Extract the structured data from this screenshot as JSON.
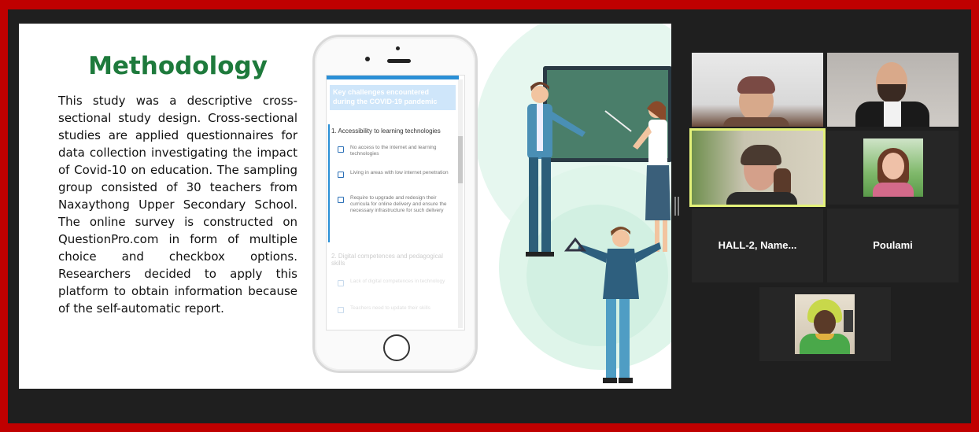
{
  "slide": {
    "title": "Methodology",
    "body": "This study was a descriptive cross-sectional study design. Cross-sectional studies are applied questionnaires for data collection investigating the impact of Covid-10 on education. The sampling group consisted of 30 teachers from Naxaythong Upper Secondary School. The online survey is constructed on QuestionPro.com in form of multiple choice and checkbox options. Researchers decided to apply this platform to obtain information because of the self-automatic report.",
    "phone": {
      "banner": "Key challenges encountered during the COVID-19 pandemic",
      "question1": "1. Accessibility to learning technologies",
      "options1": [
        "No access to the internet and learning technologies",
        "Living in areas with low internet penetration",
        "Require to upgrade and redesign their curricula for online delivery and ensure the necessary infrastructure for such delivery"
      ],
      "question2": "2. Digital competences and pedagogical skills",
      "options2": [
        "Lack of digital competences in technology",
        "Teachers need to update their skills"
      ]
    }
  },
  "participants": [
    {
      "name": "",
      "has_video": true
    },
    {
      "name": "",
      "has_video": true
    },
    {
      "name": "",
      "has_video": true,
      "active_speaker": true
    },
    {
      "name": "",
      "has_video": true
    },
    {
      "name": "HALL-2, Name...",
      "has_video": false
    },
    {
      "name": "Poulami",
      "has_video": false
    },
    {
      "name": "",
      "has_video": true
    }
  ],
  "colors": {
    "frame_border": "#c00000",
    "title_green": "#1e7a3c",
    "active_speaker_border": "#e4f27a"
  }
}
